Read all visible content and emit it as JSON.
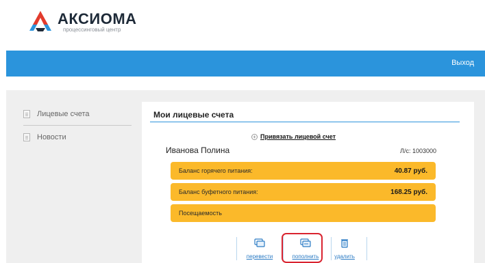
{
  "brand": {
    "name": "АКСИОМА",
    "subtitle": "процессинговый центр"
  },
  "topbar": {
    "logout_label": "Выход"
  },
  "sidebar": {
    "items": [
      {
        "label": "Лицевые счета",
        "icon": "document-icon"
      },
      {
        "label": "Новости",
        "icon": "document-icon"
      }
    ]
  },
  "panel": {
    "title": "Мои лицевые счета",
    "bind_link": "Привязать лицевой счет",
    "owner": "Иванова Полина",
    "account": "Л/с: 1003000",
    "balances": [
      {
        "label": "Баланс горячего питания:",
        "value": "40.87 руб."
      },
      {
        "label": "Баланс буфетного питания:",
        "value": "168.25 руб."
      },
      {
        "label": "Посещаемость",
        "value": ""
      }
    ],
    "actions": [
      {
        "label": "перевести",
        "icon": "transfer-icon"
      },
      {
        "label": "пополнить",
        "icon": "topup-icon"
      },
      {
        "label": "удалить",
        "icon": "trash-icon"
      }
    ]
  },
  "colors": {
    "topbar": "#2b94dc",
    "balance_bar": "#fbb92a",
    "highlight": "#d9232f",
    "link": "#2b7bc4"
  }
}
